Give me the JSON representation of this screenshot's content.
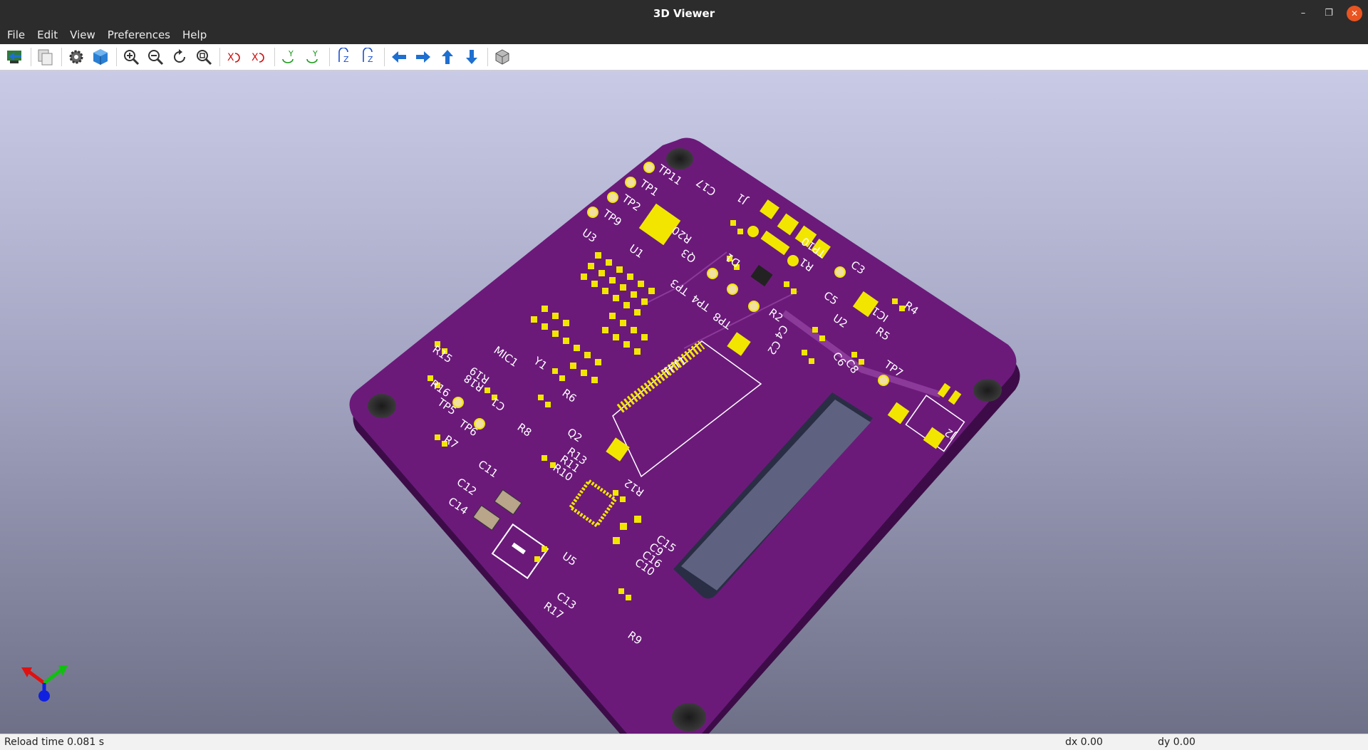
{
  "window": {
    "title": "3D Viewer"
  },
  "menu": [
    "File",
    "Edit",
    "View",
    "Preferences",
    "Help"
  ],
  "toolbar": [
    {
      "name": "reload-board-button",
      "icon": "reload-board-icon"
    },
    {
      "name": "copy-to-clipboard-button",
      "icon": "copy-icon"
    },
    {
      "name": "options-button",
      "icon": "gear-icon"
    },
    {
      "name": "raytracing-button",
      "icon": "cube-render-icon"
    },
    {
      "name": "zoom-in-button",
      "icon": "zoom-in-icon"
    },
    {
      "name": "zoom-out-button",
      "icon": "zoom-out-icon"
    },
    {
      "name": "refresh-button",
      "icon": "refresh-icon"
    },
    {
      "name": "zoom-fit-button",
      "icon": "zoom-fit-icon"
    },
    {
      "name": "rotate-x-cw-button",
      "icon": "rotate-x-cw-icon"
    },
    {
      "name": "rotate-x-ccw-button",
      "icon": "rotate-x-ccw-icon"
    },
    {
      "name": "rotate-y-cw-button",
      "icon": "rotate-y-cw-icon"
    },
    {
      "name": "rotate-y-ccw-button",
      "icon": "rotate-y-ccw-icon"
    },
    {
      "name": "rotate-z-cw-button",
      "icon": "rotate-z-cw-icon"
    },
    {
      "name": "rotate-z-ccw-button",
      "icon": "rotate-z-ccw-icon"
    },
    {
      "name": "move-left-button",
      "icon": "arrow-left-icon"
    },
    {
      "name": "move-right-button",
      "icon": "arrow-right-icon"
    },
    {
      "name": "move-up-button",
      "icon": "arrow-up-icon"
    },
    {
      "name": "move-down-button",
      "icon": "arrow-down-icon"
    },
    {
      "name": "orthographic-button",
      "icon": "ortho-cube-icon"
    }
  ],
  "board": {
    "color": "#6b1a7a",
    "pad_color": "#f2e600",
    "labels": [
      "TP11",
      "TP1",
      "TP2",
      "TP9",
      "U3",
      "U1",
      "C17",
      "J1",
      "R20",
      "Q3",
      "D1",
      "TP10",
      "R1",
      "C3",
      "R4",
      "IC1",
      "TP3",
      "TP4",
      "TP8",
      "R2",
      "C5",
      "U2",
      "R5",
      "C4",
      "C2",
      "C6",
      "C8",
      "TP7",
      "J2",
      "MIC1",
      "R15",
      "Y1",
      "R19",
      "R18",
      "R16",
      "C1",
      "R6",
      "TFT1",
      "TP5",
      "TP6",
      "R7",
      "R8",
      "Q2",
      "C11",
      "R13",
      "R11",
      "R10",
      "C12",
      "R12",
      "C14",
      "U5",
      "C15",
      "C9",
      "C16",
      "C10",
      "C13",
      "R17",
      "R9"
    ]
  },
  "axes": {
    "x_color": "#e01010",
    "y_color": "#10c010",
    "z_color": "#1020e0"
  },
  "status": {
    "reload": "Reload time 0.081 s",
    "dx": "dx 0.00",
    "dy": "dy 0.00"
  }
}
